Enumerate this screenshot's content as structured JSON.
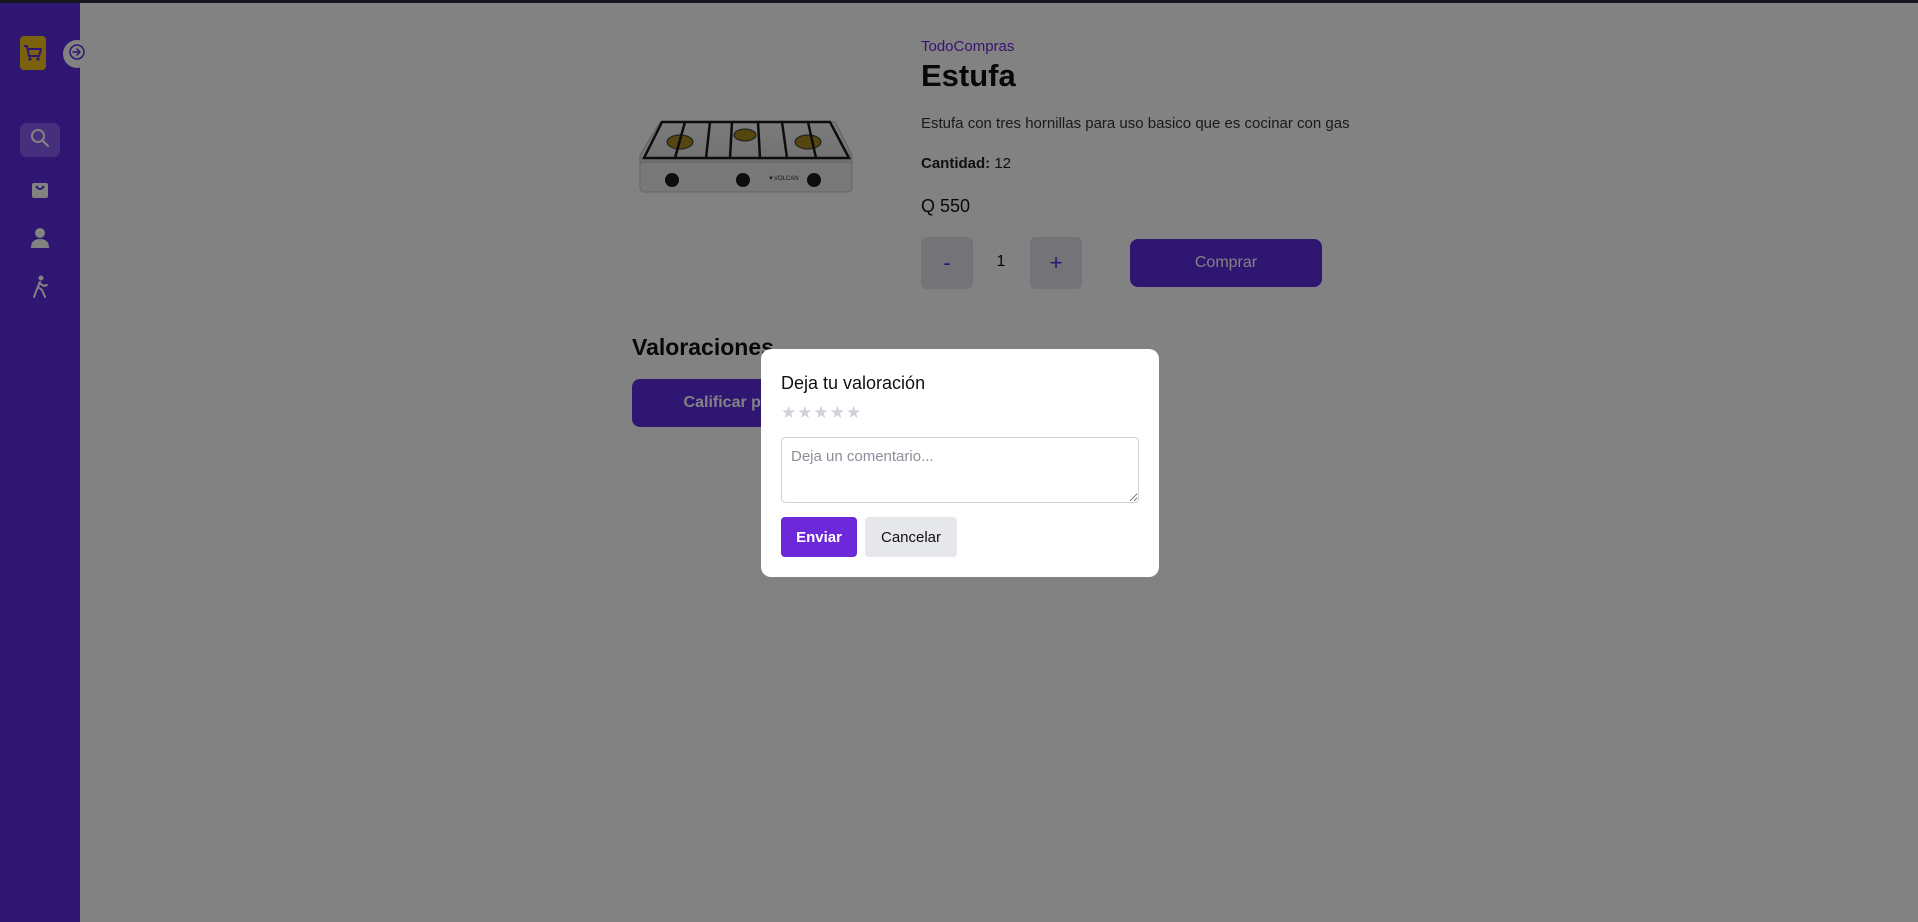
{
  "sidebar": {
    "items": [
      {
        "icon": "search-icon",
        "active": true
      },
      {
        "icon": "cart-icon",
        "active": false
      },
      {
        "icon": "user-icon",
        "active": false
      },
      {
        "icon": "walking-exit-icon",
        "active": false
      }
    ]
  },
  "product": {
    "brand": "TodoCompras",
    "title": "Estufa",
    "description": "Estufa con tres hornillas para uso basico que es cocinar con gas",
    "stock_label": "Cantidad:",
    "stock_value": "12",
    "price": "Q 550",
    "quantity": "1",
    "minus_label": "-",
    "plus_label": "+",
    "buy_label": "Comprar"
  },
  "ratings": {
    "title": "Valoraciones",
    "rate_button_label": "Calificar producto"
  },
  "modal": {
    "title": "Deja tu valoración",
    "stars": [
      "★",
      "★",
      "★",
      "★",
      "★"
    ],
    "rating": 0,
    "comment_placeholder": "Deja un comentario...",
    "send_label": "Enviar",
    "cancel_label": "Cancelar"
  },
  "colors": {
    "primary": "#5b2be0",
    "logo": "#f2c21b",
    "star_empty": "#cfd2d9"
  }
}
